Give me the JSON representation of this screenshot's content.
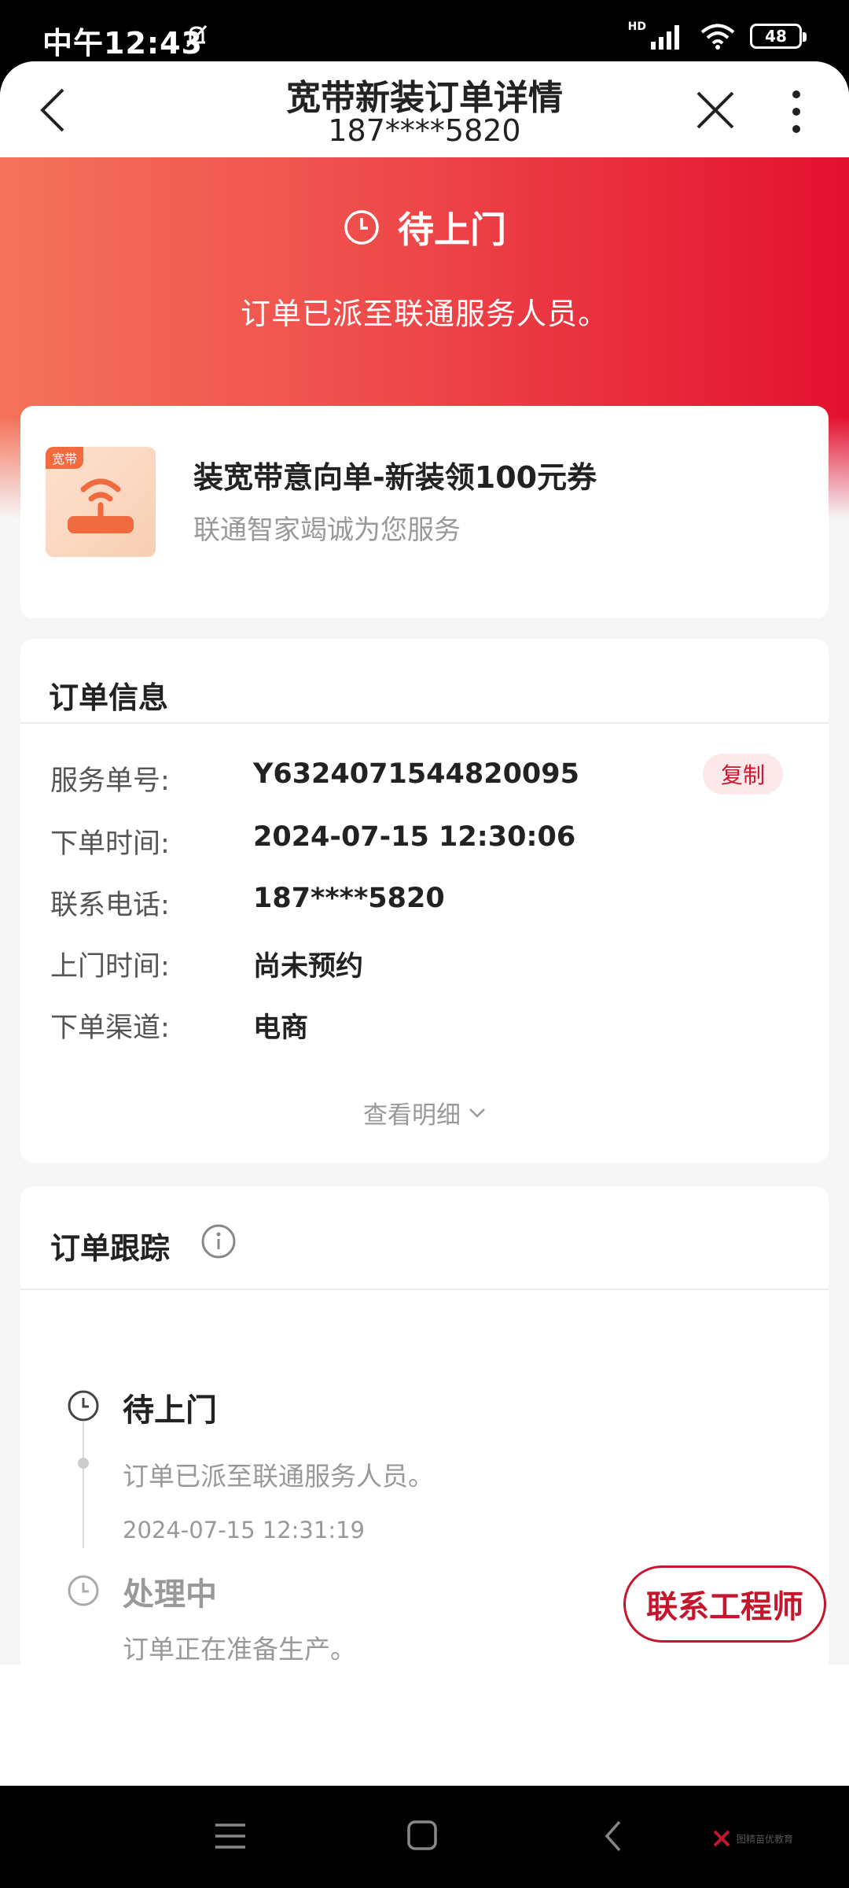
{
  "status_bar": {
    "time": "中午12:43",
    "network": "HD",
    "battery": "48"
  },
  "nav": {
    "title": "宽带新装订单详情",
    "subtitle": "187****5820"
  },
  "order_status": {
    "title": "待上门",
    "description": "订单已派至联通服务人员。"
  },
  "product": {
    "tag": "宽带",
    "title": "装宽带意向单-新装领100元券",
    "subtitle": "联通智家竭诚为您服务"
  },
  "order_info": {
    "heading": "订单信息",
    "copy_label": "复制",
    "rows": [
      {
        "label": "服务单号:",
        "value": "Y6324071544820095"
      },
      {
        "label": "下单时间:",
        "value": "2024-07-15 12:30:06"
      },
      {
        "label": "联系电话:",
        "value": "187****5820"
      },
      {
        "label": "上门时间:",
        "value": "尚未预约"
      },
      {
        "label": "下单渠道:",
        "value": "电商"
      }
    ],
    "detail_toggle": "查看明细"
  },
  "tracking": {
    "heading": "订单跟踪",
    "events": [
      {
        "title": "待上门",
        "desc": "订单已派至联通服务人员。",
        "time": "2024-07-15 12:31:19"
      },
      {
        "title": "处理中",
        "desc": "订单正在准备生产。"
      }
    ]
  },
  "actions": {
    "contact": "联系工程师"
  },
  "watermark": {
    "text": "图精苗优教育"
  },
  "colors": {
    "brand_red": "#e3102f",
    "accent_red": "#c4172e"
  }
}
